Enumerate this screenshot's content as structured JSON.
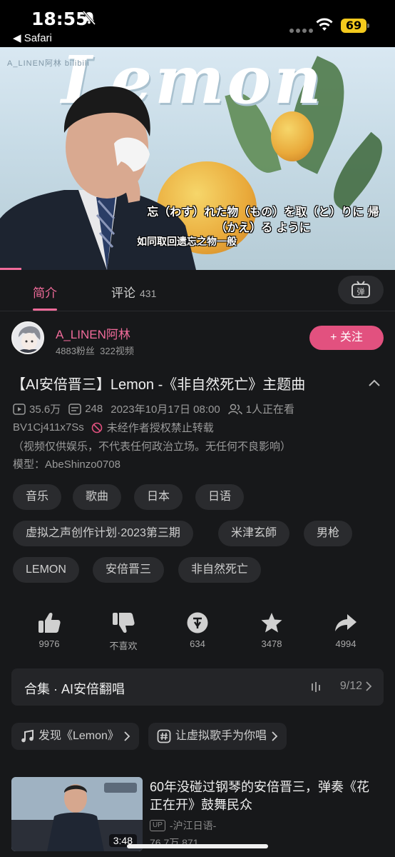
{
  "status_bar": {
    "time": "18:55",
    "back_label": "◀ Safari",
    "battery": "69"
  },
  "video": {
    "watermark": "A_LINEN阿林  bilibili",
    "title_art": "Lemon",
    "subtitle_line1": "忘（わす）れた物（もの）を取（と）りに 帰（かえ）る ように",
    "subtitle_line2": "如同取回遗忘之物一般"
  },
  "tabs": {
    "intro": "简介",
    "comments": "评论",
    "comments_count": "431",
    "danmaku_icon": "danmaku-toggle-icon"
  },
  "uploader": {
    "name": "A_LINEN阿林",
    "followers": "4883粉丝",
    "videos": "322视频",
    "follow_label": "+ 关注"
  },
  "video_info": {
    "title": "【AI安倍晋三】Lemon -《非自然死亡》主题曲",
    "views": "35.6万",
    "danmaku": "248",
    "date": "2023年10月17日 08:00",
    "watching": "1人正在看",
    "bvid": "BV1Cj411x7Ss",
    "repost_notice": "未经作者授权禁止转载",
    "disclaimer": "（视频仅供娱乐，不代表任何政治立场。无任何不良影响）",
    "model": "模型：AbeShinzo0708"
  },
  "tags": [
    "音乐",
    "歌曲",
    "日本",
    "日语",
    "虚拟之声创作计划·2023第三期",
    "米津玄師",
    "男枪",
    "LEMON",
    "安倍晋三",
    "非自然死亡"
  ],
  "actions": {
    "like": "9976",
    "dislike": "不喜欢",
    "coin": "634",
    "favorite": "3478",
    "share": "4994"
  },
  "collection": {
    "title": "合集 · AI安倍翻唱",
    "progress": "9/12"
  },
  "chips": {
    "discover": "发现《Lemon》",
    "virtual_singer": "让虚拟歌手为你唱"
  },
  "recommendation": {
    "title": "60年没碰过钢琴的安倍晋三，弹奏《花正在开》鼓舞民众",
    "up_badge": "UP",
    "up_name": "-沪江日语-",
    "duration": "3:48",
    "stats": "76.7万   871"
  },
  "colors": {
    "accent": "#f06b9a",
    "background": "#17181a",
    "follow_button": "#e2517f"
  }
}
